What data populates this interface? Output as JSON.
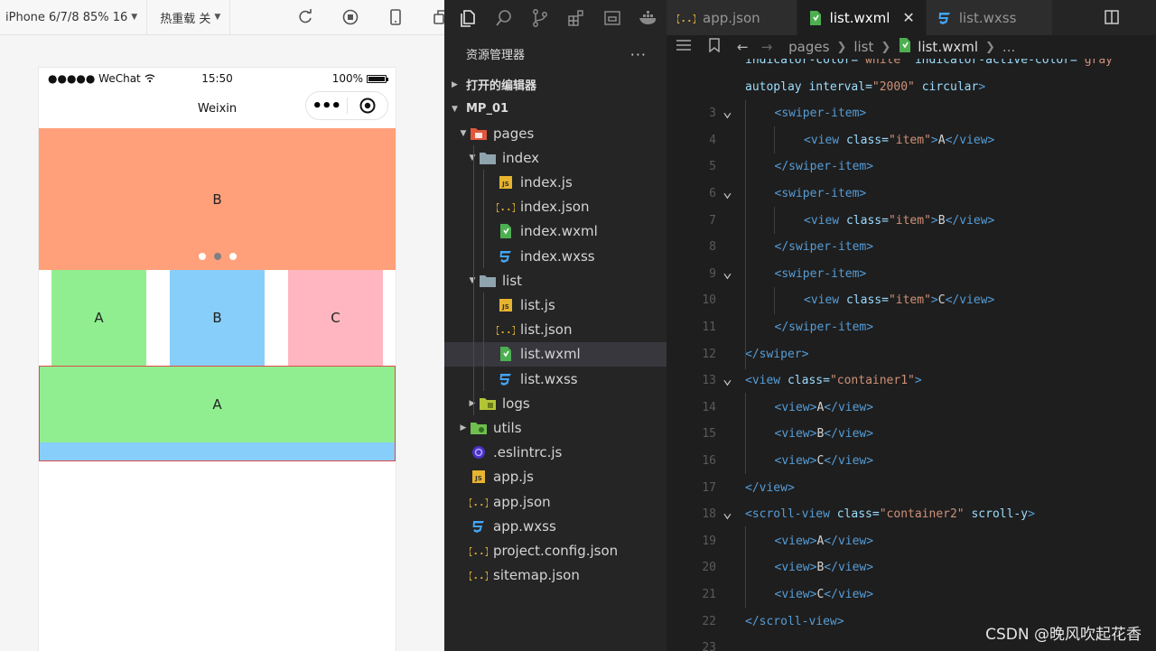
{
  "simulator": {
    "device_label": "iPhone 6/7/8 85% 16",
    "hot_reload_label": "热重载 关",
    "status": {
      "carrier": "●●●●● WeChat",
      "time": "15:50",
      "battery": "100%"
    },
    "nav_title": "Weixin",
    "capsule": {
      "menu": "•••",
      "record": "◉"
    },
    "swiper": {
      "current_label": "B",
      "dot_count": 3,
      "active_dot_index": 1,
      "dot_color": "#ffffff",
      "active_dot_color": "#808080",
      "bg": "#ffa07a"
    },
    "container1": [
      {
        "label": "A",
        "color": "#90ee90"
      },
      {
        "label": "B",
        "color": "#87cefa"
      },
      {
        "label": "C",
        "color": "#ffb6c1"
      }
    ],
    "container2": [
      {
        "label": "A",
        "color": "#90ee90"
      },
      {
        "label": "",
        "color": "#87cefa"
      }
    ]
  },
  "explorer": {
    "title": "资源管理器",
    "more": "···",
    "open_editors": "打开的编辑器",
    "project": "MP_01",
    "tree": [
      {
        "name": "pages",
        "type": "folder-pages",
        "depth": 1,
        "expanded": true
      },
      {
        "name": "index",
        "type": "folder",
        "depth": 2,
        "expanded": true
      },
      {
        "name": "index.js",
        "type": "js",
        "depth": 3
      },
      {
        "name": "index.json",
        "type": "json",
        "depth": 3
      },
      {
        "name": "index.wxml",
        "type": "wxml",
        "depth": 3
      },
      {
        "name": "index.wxss",
        "type": "wxss",
        "depth": 3
      },
      {
        "name": "list",
        "type": "folder",
        "depth": 2,
        "expanded": true
      },
      {
        "name": "list.js",
        "type": "js",
        "depth": 3
      },
      {
        "name": "list.json",
        "type": "json",
        "depth": 3
      },
      {
        "name": "list.wxml",
        "type": "wxml",
        "depth": 3,
        "selected": true
      },
      {
        "name": "list.wxss",
        "type": "wxss",
        "depth": 3
      },
      {
        "name": "logs",
        "type": "folder-logs",
        "depth": 2,
        "expanded": false
      },
      {
        "name": "utils",
        "type": "folder-utils",
        "depth": 1,
        "expanded": false
      },
      {
        "name": ".eslintrc.js",
        "type": "eslint",
        "depth": 1
      },
      {
        "name": "app.js",
        "type": "js",
        "depth": 1
      },
      {
        "name": "app.json",
        "type": "json",
        "depth": 1
      },
      {
        "name": "app.wxss",
        "type": "wxss",
        "depth": 1
      },
      {
        "name": "project.config.json",
        "type": "json",
        "depth": 1
      },
      {
        "name": "sitemap.json",
        "type": "json",
        "depth": 1
      }
    ]
  },
  "editor": {
    "tabs": [
      {
        "label": "app.json",
        "type": "json",
        "active": false
      },
      {
        "label": "list.wxml",
        "type": "wxml",
        "active": true
      },
      {
        "label": "list.wxss",
        "type": "wxss",
        "active": false
      }
    ],
    "breadcrumb": {
      "parts": [
        "pages",
        "list"
      ],
      "file": "list.wxml",
      "tail": "..."
    },
    "lines": [
      {
        "n": "",
        "indent": 0,
        "fold": false,
        "tokens": [
          [
            "at",
            "indicator-color="
          ],
          [
            "st",
            "\"white\""
          ],
          [
            "pl",
            " "
          ],
          [
            "at",
            "indicator-active-color="
          ],
          [
            "st",
            "\"gray\""
          ]
        ]
      },
      {
        "n": "",
        "indent": 0,
        "fold": false,
        "tokens": [
          [
            "at",
            "autoplay"
          ],
          [
            "pl",
            " "
          ],
          [
            "at",
            "interval="
          ],
          [
            "st",
            "\"2000\""
          ],
          [
            "pl",
            " "
          ],
          [
            "at",
            "circular"
          ],
          [
            "tg",
            ">"
          ]
        ]
      },
      {
        "n": "3",
        "indent": 1,
        "fold": true,
        "tokens": [
          [
            "tg",
            "<swiper-item>"
          ]
        ]
      },
      {
        "n": "4",
        "indent": 2,
        "fold": false,
        "tokens": [
          [
            "tg",
            "<view"
          ],
          [
            "pl",
            " "
          ],
          [
            "at",
            "class="
          ],
          [
            "st",
            "\"item\""
          ],
          [
            "tg",
            ">"
          ],
          [
            "pl",
            "A"
          ],
          [
            "tg",
            "</view>"
          ]
        ]
      },
      {
        "n": "5",
        "indent": 1,
        "fold": false,
        "tokens": [
          [
            "tg",
            "</swiper-item>"
          ]
        ]
      },
      {
        "n": "6",
        "indent": 1,
        "fold": true,
        "tokens": [
          [
            "tg",
            "<swiper-item>"
          ]
        ]
      },
      {
        "n": "7",
        "indent": 2,
        "fold": false,
        "tokens": [
          [
            "tg",
            "<view"
          ],
          [
            "pl",
            " "
          ],
          [
            "at",
            "class="
          ],
          [
            "st",
            "\"item\""
          ],
          [
            "tg",
            ">"
          ],
          [
            "pl",
            "B"
          ],
          [
            "tg",
            "</view>"
          ]
        ]
      },
      {
        "n": "8",
        "indent": 1,
        "fold": false,
        "tokens": [
          [
            "tg",
            "</swiper-item>"
          ]
        ]
      },
      {
        "n": "9",
        "indent": 1,
        "fold": true,
        "tokens": [
          [
            "tg",
            "<swiper-item>"
          ]
        ]
      },
      {
        "n": "10",
        "indent": 2,
        "fold": false,
        "tokens": [
          [
            "tg",
            "<view"
          ],
          [
            "pl",
            " "
          ],
          [
            "at",
            "class="
          ],
          [
            "st",
            "\"item\""
          ],
          [
            "tg",
            ">"
          ],
          [
            "pl",
            "C"
          ],
          [
            "tg",
            "</view>"
          ]
        ]
      },
      {
        "n": "11",
        "indent": 1,
        "fold": false,
        "tokens": [
          [
            "tg",
            "</swiper-item>"
          ]
        ]
      },
      {
        "n": "12",
        "indent": 0,
        "fold": false,
        "tokens": [
          [
            "tg",
            "</swiper>"
          ]
        ]
      },
      {
        "n": "13",
        "indent": 0,
        "fold": true,
        "tokens": [
          [
            "tg",
            "<view"
          ],
          [
            "pl",
            " "
          ],
          [
            "at",
            "class="
          ],
          [
            "st",
            "\"container1\""
          ],
          [
            "tg",
            ">"
          ]
        ]
      },
      {
        "n": "14",
        "indent": 1,
        "fold": false,
        "tokens": [
          [
            "tg",
            "<view>"
          ],
          [
            "pl",
            "A"
          ],
          [
            "tg",
            "</view>"
          ]
        ]
      },
      {
        "n": "15",
        "indent": 1,
        "fold": false,
        "tokens": [
          [
            "tg",
            "<view>"
          ],
          [
            "pl",
            "B"
          ],
          [
            "tg",
            "</view>"
          ]
        ]
      },
      {
        "n": "16",
        "indent": 1,
        "fold": false,
        "tokens": [
          [
            "tg",
            "<view>"
          ],
          [
            "pl",
            "C"
          ],
          [
            "tg",
            "</view>"
          ]
        ]
      },
      {
        "n": "17",
        "indent": 0,
        "fold": false,
        "tokens": [
          [
            "tg",
            "</view>"
          ]
        ]
      },
      {
        "n": "18",
        "indent": 0,
        "fold": true,
        "tokens": [
          [
            "tg",
            "<scroll-view"
          ],
          [
            "pl",
            " "
          ],
          [
            "at",
            "class="
          ],
          [
            "st",
            "\"container2\""
          ],
          [
            "pl",
            " "
          ],
          [
            "at",
            "scroll-y"
          ],
          [
            "tg",
            ">"
          ]
        ]
      },
      {
        "n": "19",
        "indent": 1,
        "fold": false,
        "tokens": [
          [
            "tg",
            "<view>"
          ],
          [
            "pl",
            "A"
          ],
          [
            "tg",
            "</view>"
          ]
        ]
      },
      {
        "n": "20",
        "indent": 1,
        "fold": false,
        "tokens": [
          [
            "tg",
            "<view>"
          ],
          [
            "pl",
            "B"
          ],
          [
            "tg",
            "</view>"
          ]
        ]
      },
      {
        "n": "21",
        "indent": 1,
        "fold": false,
        "tokens": [
          [
            "tg",
            "<view>"
          ],
          [
            "pl",
            "C"
          ],
          [
            "tg",
            "</view>"
          ]
        ]
      },
      {
        "n": "22",
        "indent": 0,
        "fold": false,
        "tokens": [
          [
            "tg",
            "</scroll-view>"
          ]
        ]
      },
      {
        "n": "23",
        "indent": 0,
        "fold": false,
        "tokens": []
      }
    ],
    "syntax_colors": {
      "tag": "#569cd6",
      "attr": "#9cdcfe",
      "string": "#ce9178",
      "text": "#d4d4d4"
    }
  },
  "watermark": "CSDN @晚风吹起花香"
}
